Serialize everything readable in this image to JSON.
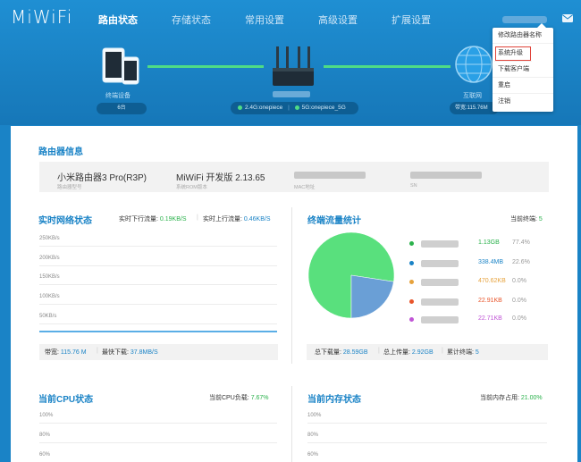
{
  "header": {
    "logo": "MiWiFi",
    "nav": [
      "路由状态",
      "存储状态",
      "常用设置",
      "高级设置",
      "扩展设置"
    ]
  },
  "diagram": {
    "devices_label": "终端设备",
    "devices_count": "6台",
    "wifi_24": "2.4G:onepiece",
    "wifi_5": "5G:onepiece_5G",
    "internet_label": "互联网",
    "internet_bandwidth": "带宽:115.76M"
  },
  "menu": {
    "items": [
      "修改路由器名称",
      "系统升级",
      "下载客户端",
      "重启",
      "注销"
    ]
  },
  "router_info": {
    "title": "路由器信息",
    "model_value": "小米路由器3 Pro(R3P)",
    "model_label": "路由器型号",
    "rom_value": "MiWiFi 开发版 2.13.65",
    "rom_label": "系统ROM版本",
    "mac_label": "MAC地址",
    "sn_label": "SN"
  },
  "network": {
    "title": "实时网络状态",
    "down_label": "实时下行流量:",
    "down_value": "0.19KB/S",
    "up_label": "实时上行流量:",
    "up_value": "0.46KB/S",
    "ticks": [
      "250KB/s",
      "200KB/s",
      "150KB/s",
      "100KB/s",
      "50KB/s"
    ],
    "footer_bw_label": "带宽:",
    "footer_bw_value": "115.76 M",
    "footer_max_label": "最快下载:",
    "footer_max_value": "37.8MB/S"
  },
  "terminal": {
    "title": "终端流量统计",
    "current_label": "当前终端:",
    "current_value": "5",
    "legend": [
      {
        "value": "1.13GB",
        "pct": "77.4%",
        "color": "#2bb24c"
      },
      {
        "value": "338.4MB",
        "pct": "22.6%",
        "color": "#1a83c6"
      },
      {
        "value": "470.62KB",
        "pct": "0.0%",
        "color": "#e6a23c"
      },
      {
        "value": "22.91KB",
        "pct": "0.0%",
        "color": "#e8542a"
      },
      {
        "value": "22.71KB",
        "pct": "0.0%",
        "color": "#c055d6"
      }
    ],
    "pie_colors": [
      "#59e07d",
      "#6a9fd6"
    ],
    "pie_shares": [
      0.774,
      0.226
    ],
    "footer_down_label": "总下载量:",
    "footer_down_value": "28.59GB",
    "footer_up_label": "总上传量:",
    "footer_up_value": "2.92GB",
    "footer_total_label": "累计终端:",
    "footer_total_value": "5"
  },
  "cpu": {
    "title": "当前CPU状态",
    "load_label": "当前CPU负载:",
    "load_value": "7.67%",
    "ticks": [
      "100%",
      "80%",
      "60%"
    ]
  },
  "memory": {
    "title": "当前内存状态",
    "usage_label": "当前内存占用:",
    "usage_value": "21.00%",
    "ticks": [
      "100%",
      "80%",
      "60%"
    ]
  }
}
